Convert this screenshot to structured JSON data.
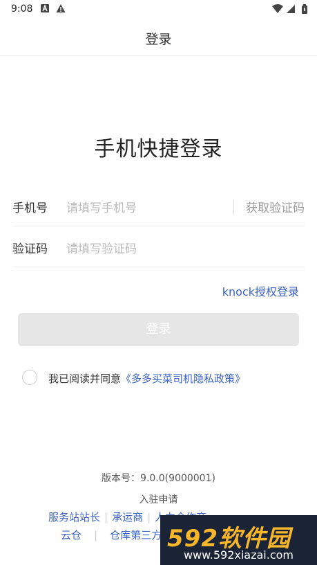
{
  "status_bar": {
    "time": "9:08",
    "icons": [
      "notification-a-icon",
      "warning-icon",
      "wifi-icon",
      "signal-icon",
      "battery-icon"
    ]
  },
  "header": {
    "title": "登录"
  },
  "heading": "手机快捷登录",
  "phone_row": {
    "label": "手机号",
    "placeholder": "请填写手机号",
    "get_code": "获取验证码"
  },
  "code_row": {
    "label": "验证码",
    "placeholder": "请填写验证码"
  },
  "knock_link": "knock授权登录",
  "login_button": "登录",
  "agreement": {
    "prefix": "我已阅读并同意",
    "policy": "《多多买菜司机隐私政策》",
    "checked": false
  },
  "footer": {
    "version": "版本号：9.0.0(9000001)",
    "apply": "入驻申请",
    "links_row1": [
      "服务站站长",
      "承运商",
      "人力合作商"
    ],
    "links_row2": [
      "云仓",
      "仓库第三方"
    ]
  },
  "watermark": {
    "top": "592软件园",
    "bottom": "www.592xiazai.com"
  },
  "colors": {
    "link": "#3b63c4",
    "button_disabled": "#e6e6e6",
    "placeholder": "#bbbbbb"
  }
}
